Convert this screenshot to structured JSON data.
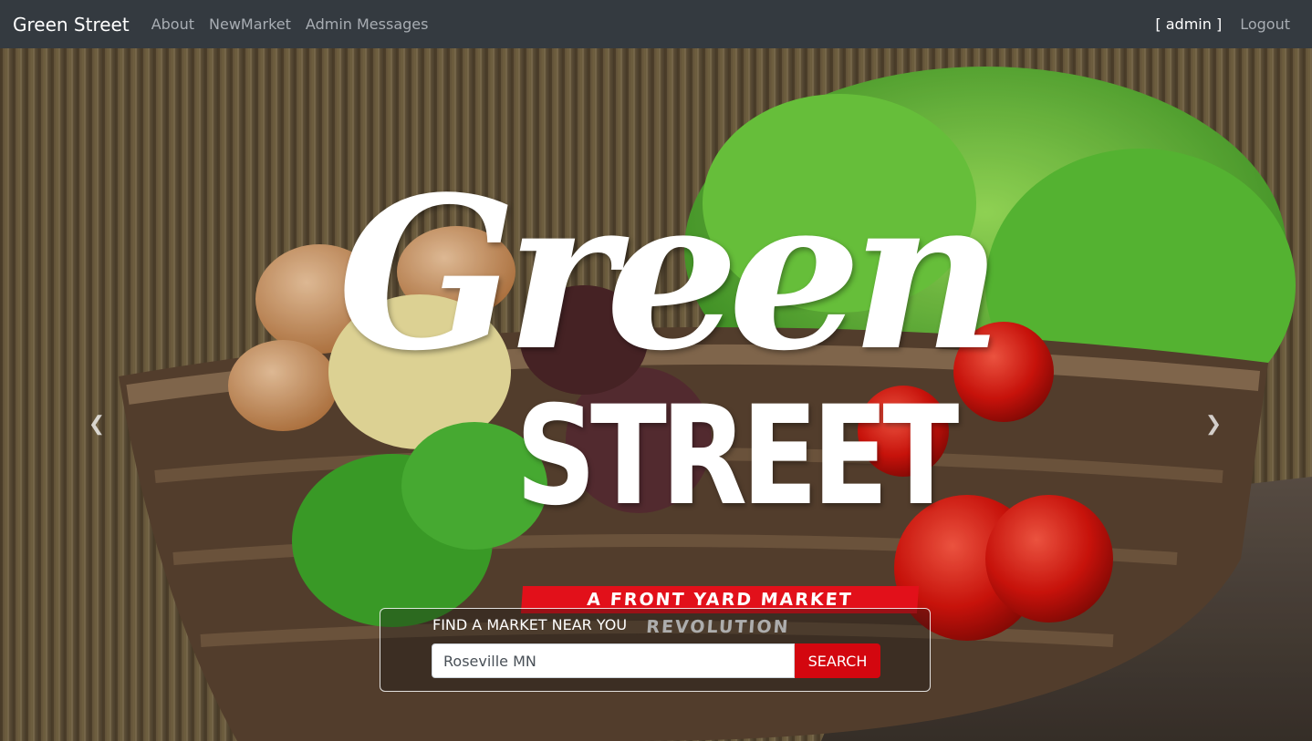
{
  "navbar": {
    "brand": "Green Street",
    "links": [
      "About",
      "NewMarket",
      "Admin Messages"
    ],
    "user": "[ admin ]",
    "logout": "Logout"
  },
  "hero": {
    "logo_word1": "Green",
    "logo_word2": "STREET",
    "tagline": "A FRONT YARD MARKET REVOLUTION",
    "prev_icon": "chevron-left-icon",
    "next_icon": "chevron-right-icon"
  },
  "search": {
    "title": "FIND A MARKET NEAR YOU",
    "value": "Roseville MN",
    "button": "SEARCH"
  },
  "colors": {
    "navbar_bg": "#343a40",
    "accent_red": "#d3070f"
  }
}
